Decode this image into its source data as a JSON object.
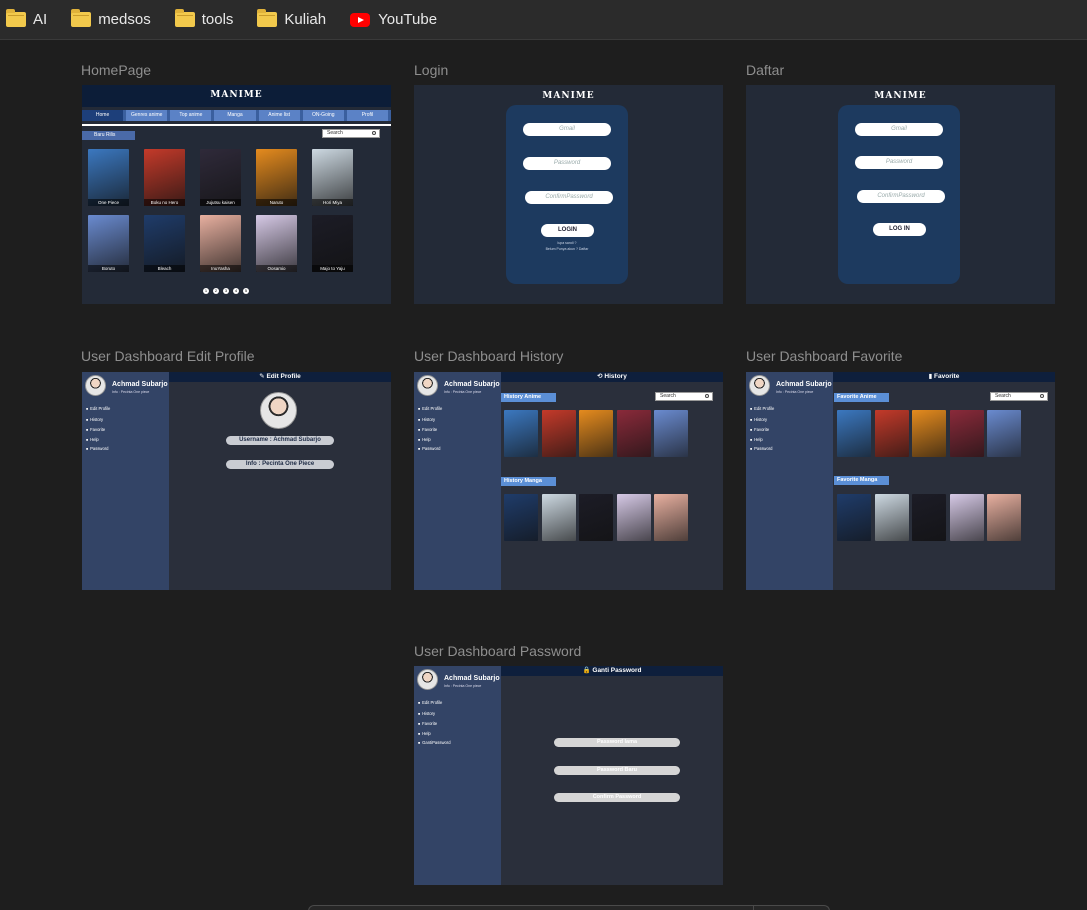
{
  "bookmarks": [
    {
      "label": "AI",
      "icon": "folder-icon"
    },
    {
      "label": "medsos",
      "icon": "folder-icon"
    },
    {
      "label": "tools",
      "icon": "folder-icon"
    },
    {
      "label": "Kuliah",
      "icon": "folder-icon"
    },
    {
      "label": "YouTube",
      "icon": "youtube-icon"
    }
  ],
  "sections": {
    "home": "HomePage",
    "login": "Login",
    "daftar": "Daftar",
    "edit": "User Dashboard Edit Profile",
    "history": "User Dashboard History",
    "favorite": "User Dashboard Favorite",
    "password": "User Dashboard Password"
  },
  "home": {
    "logo": "MANIME",
    "nav": [
      "Home",
      "Genres anime",
      "Top anime",
      "Manga",
      "Anime list",
      "ON-Going",
      "Profil"
    ],
    "baru_rilis": "Baru Rilis",
    "search_placeholder": "Search",
    "covers": [
      {
        "title": "One Piece",
        "color": "#3b78c0"
      },
      {
        "title": "Boku no Hero",
        "color": "#c43a2a"
      },
      {
        "title": "Jujutsu kaisen",
        "color": "#2f2a3a"
      },
      {
        "title": "Naruto",
        "color": "#e58b1e"
      },
      {
        "title": "Hori Miya",
        "color": "#cdd9e2"
      },
      {
        "title": "Boruto",
        "color": "#6a8bd0"
      },
      {
        "title": "Bleach",
        "color": "#1f3c6a"
      },
      {
        "title": "InuYasha",
        "color": "#e8b0a0"
      },
      {
        "title": "Oosamio",
        "color": "#d6c9e6"
      },
      {
        "title": "Majo to Yaju",
        "color": "#1c1c26"
      }
    ],
    "pages": [
      "1",
      "2",
      "3",
      "4",
      "5"
    ]
  },
  "login": {
    "logo": "MANIME",
    "gmail_placeholder": "Gmail",
    "password_placeholder": "Password",
    "confirm_placeholder": "ConfirmPassword",
    "button": "LOGIN",
    "lupa": "lupa sandi ?",
    "daftar_link": "Belum Punya akun ? Daftar"
  },
  "daftar": {
    "logo": "MANIME",
    "gmail_placeholder": "Gmail",
    "password_placeholder": "Password",
    "confirm_placeholder": "ConfirmPassword",
    "button": "LOG IN"
  },
  "dashboard": {
    "user_name": "Achmad Subarjo",
    "user_info": "Info : Pecinta One piece",
    "menu": [
      "Edit Profile",
      "History",
      "Favorite",
      "Help",
      "Password"
    ],
    "menu_pass": [
      "Edit Profile",
      "History",
      "Favorite",
      "Help",
      "GantiPassword"
    ]
  },
  "edit_profile": {
    "title": "Edit Profile",
    "username": "Username : Achmad Subarjo",
    "info": "Info : Pecinta One Piece"
  },
  "history": {
    "title": "History",
    "search_placeholder": "Search",
    "anime_label": "History Anime",
    "manga_label": "History Manga",
    "anime_colors": [
      "#3b78c0",
      "#c43a2a",
      "#e58b1e",
      "#8a2a3a",
      "#6a8bd0"
    ],
    "manga_colors": [
      "#1f3c6a",
      "#cdd9e2",
      "#1c1c26",
      "#d6c9e6",
      "#e8b0a0"
    ]
  },
  "favorite": {
    "title": "Favorite",
    "search_placeholder": "Search",
    "anime_label": "Favorite Anime",
    "manga_label": "Favorite Manga",
    "anime_colors": [
      "#3b78c0",
      "#c43a2a",
      "#e58b1e",
      "#8a2a3a",
      "#6a8bd0"
    ],
    "manga_colors": [
      "#1f3c6a",
      "#cdd9e2",
      "#1c1c26",
      "#d6c9e6",
      "#e8b0a0"
    ]
  },
  "password": {
    "title": "Ganti Password",
    "old": "Password lama",
    "new": "Password Baru",
    "confirm": "Confirm Password"
  }
}
